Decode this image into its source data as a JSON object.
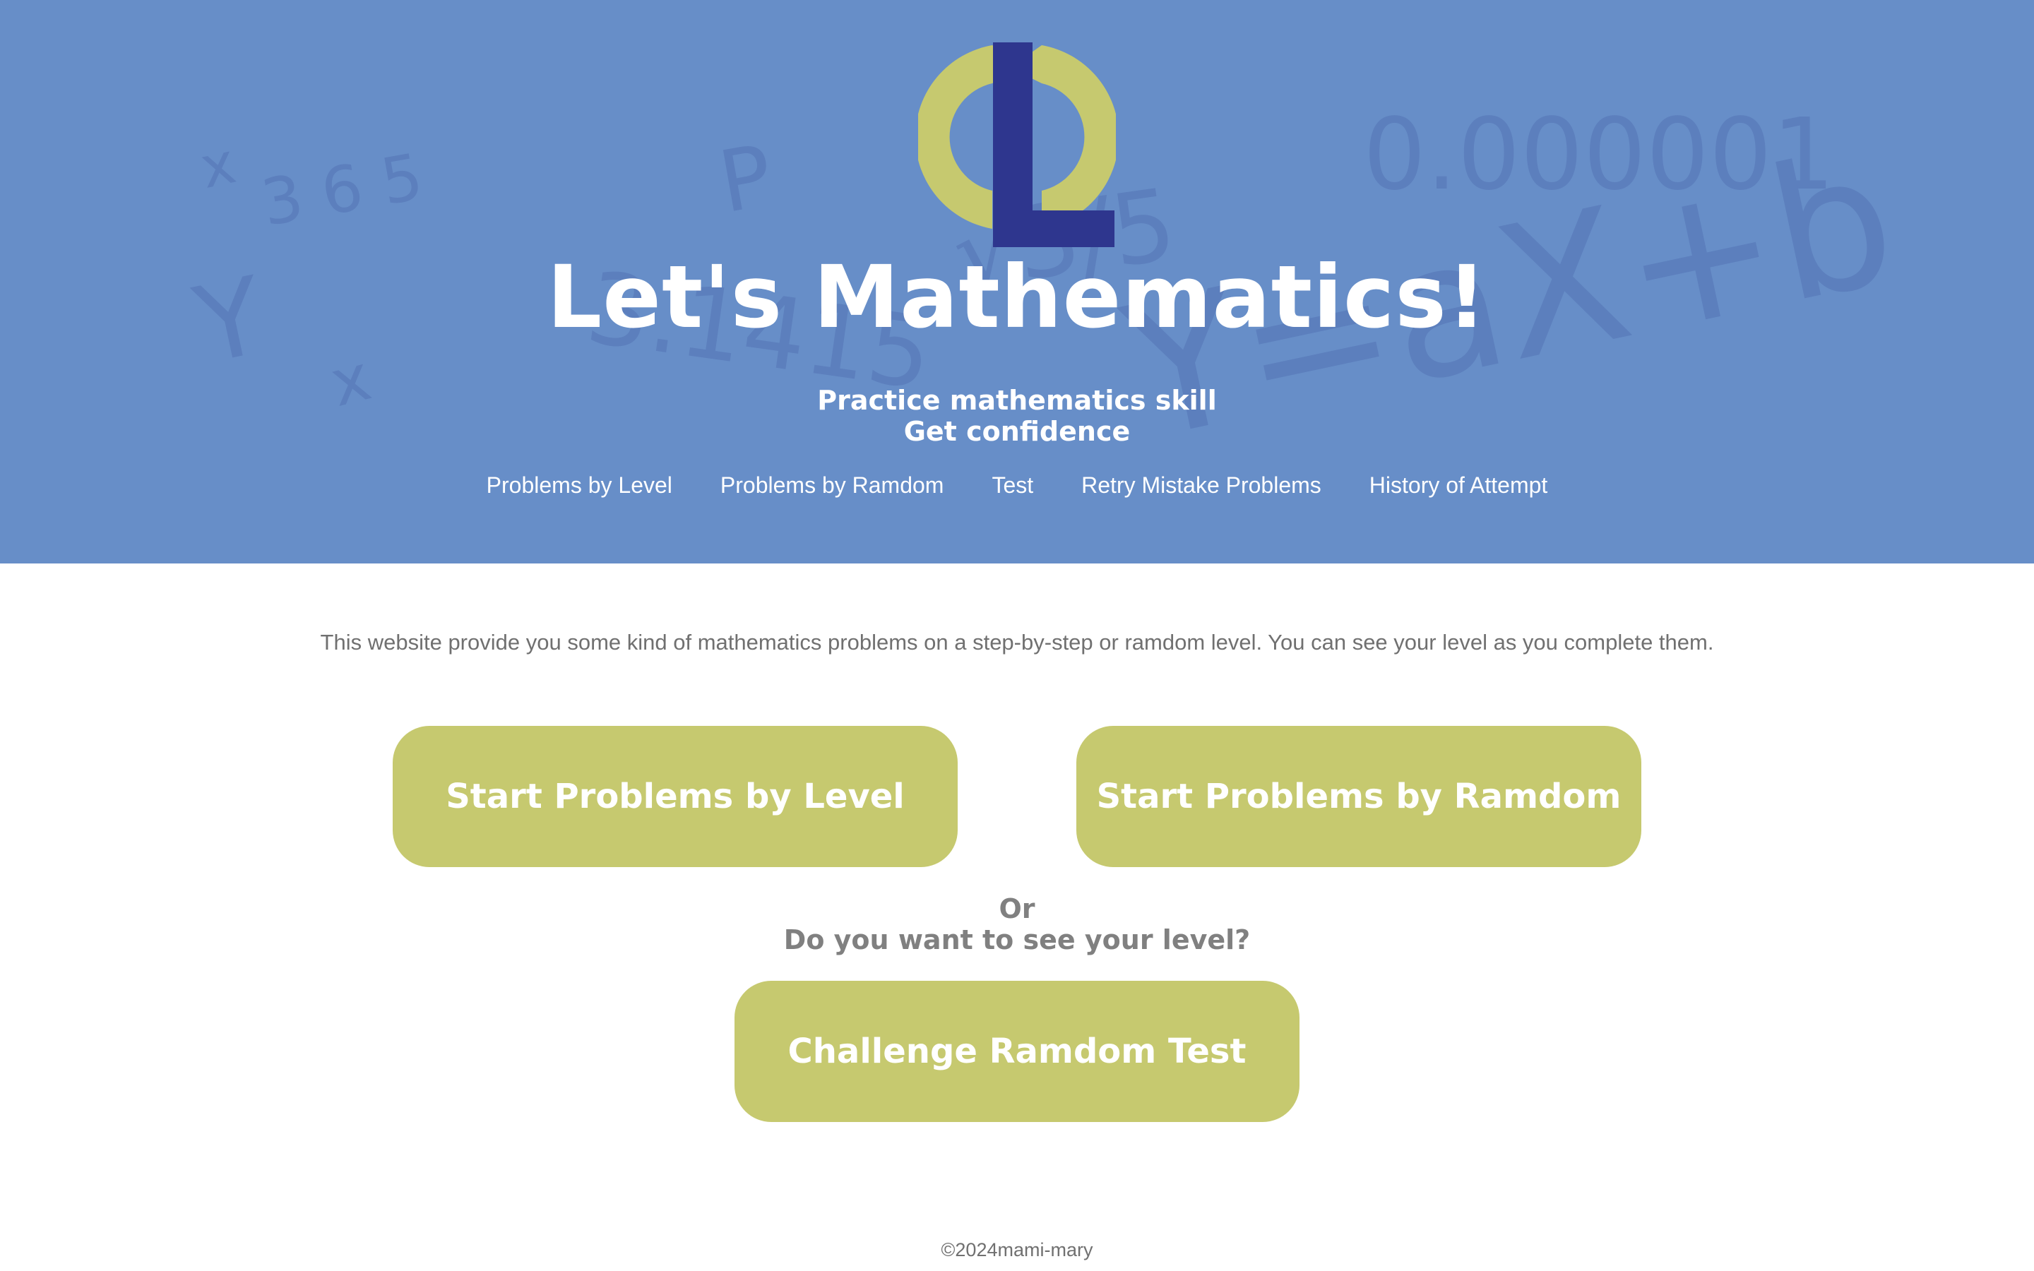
{
  "header": {
    "logo_letters": "CL",
    "title": "Let's Mathematics!",
    "subtitle_line1": "Practice mathematics skill",
    "subtitle_line2": "Get confidence"
  },
  "background_math": [
    "x",
    "3 6 5",
    "Y",
    "x",
    "P",
    "3.1415",
    "√3/5",
    "0.000001",
    "Y=aX+b"
  ],
  "nav": {
    "items": [
      {
        "label": "Problems by Level"
      },
      {
        "label": "Problems by Ramdom"
      },
      {
        "label": "Test"
      },
      {
        "label": "Retry Mistake Problems"
      },
      {
        "label": "History of Attempt"
      }
    ]
  },
  "main": {
    "intro": "This website provide you some kind of mathematics problems on a step-by-step or ramdom level. You can see your level as you complete them.",
    "start_level_label": "Start Problems by Level",
    "start_random_label": "Start Problems by Ramdom",
    "or_line1": "Or",
    "or_line2": "Do you want to see your level?",
    "test_label": "Challenge Ramdom Test"
  },
  "footer": {
    "copyright": "©2024mami-mary"
  },
  "colors": {
    "hero_bg": "#678ec8",
    "button_bg": "#c6c96f",
    "logo_navy": "#2e368e",
    "logo_olive": "#c6c96f",
    "text_gray": "#707070"
  }
}
